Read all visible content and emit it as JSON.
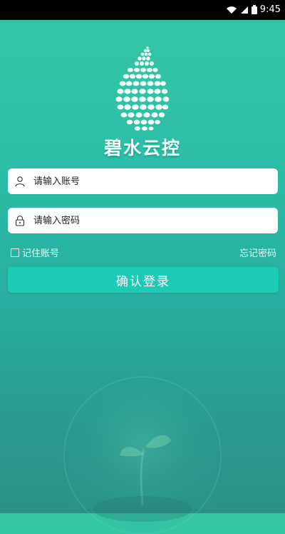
{
  "status_bar": {
    "time": "9:45",
    "icons": [
      "wifi-icon",
      "signal-icon",
      "battery-icon"
    ]
  },
  "brand": {
    "name": "碧水云控",
    "logo_icon": "water-drop-logo-icon"
  },
  "form": {
    "account_placeholder": "请输入账号",
    "password_placeholder": "请输入密码",
    "remember_label": "记住账号",
    "forgot_label": "忘记密码",
    "login_label": "确认登录"
  },
  "colors": {
    "accent": "#1ccbb6",
    "background_top": "#35c7a3",
    "background_bottom": "#2b8f87"
  }
}
